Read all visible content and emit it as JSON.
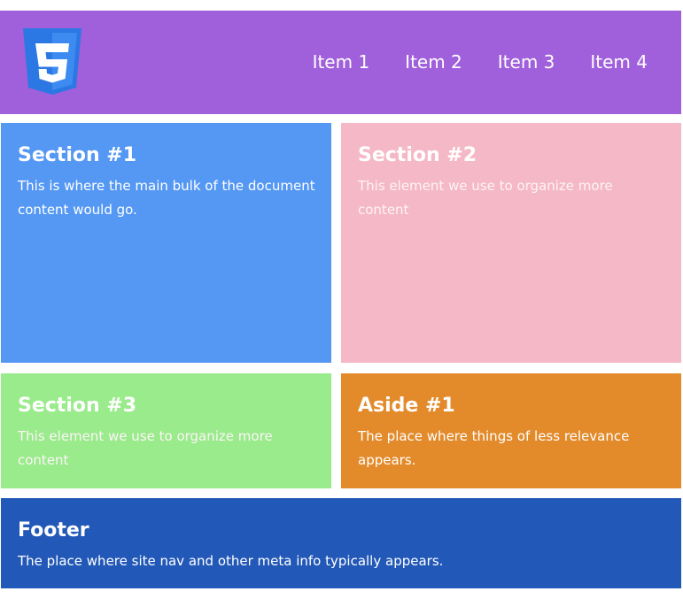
{
  "colors": {
    "header_bg": "#a05fdb",
    "section1_bg": "#5598f4",
    "section2_bg": "#f5b8c6",
    "section3_bg": "#99eb8b",
    "aside1_bg": "#e38b2b",
    "footer_bg": "#2258b7",
    "logo_shield": "#2b78e4"
  },
  "header": {
    "logo_icon": "css3-icon",
    "nav": [
      "Item 1",
      "Item 2",
      "Item 3",
      "Item 4"
    ]
  },
  "section1": {
    "title": "Section #1",
    "text": "This is where the main bulk of the document content would go."
  },
  "section2": {
    "title": "Section #2",
    "text": "This element we use to organize more content"
  },
  "section3": {
    "title": "Section #3",
    "text": "This element we use to organize more content"
  },
  "aside1": {
    "title": "Aside #1",
    "text": "The place where things of less relevance appears."
  },
  "footer": {
    "title": "Footer",
    "text": "The place where site nav and other meta info typically appears."
  }
}
